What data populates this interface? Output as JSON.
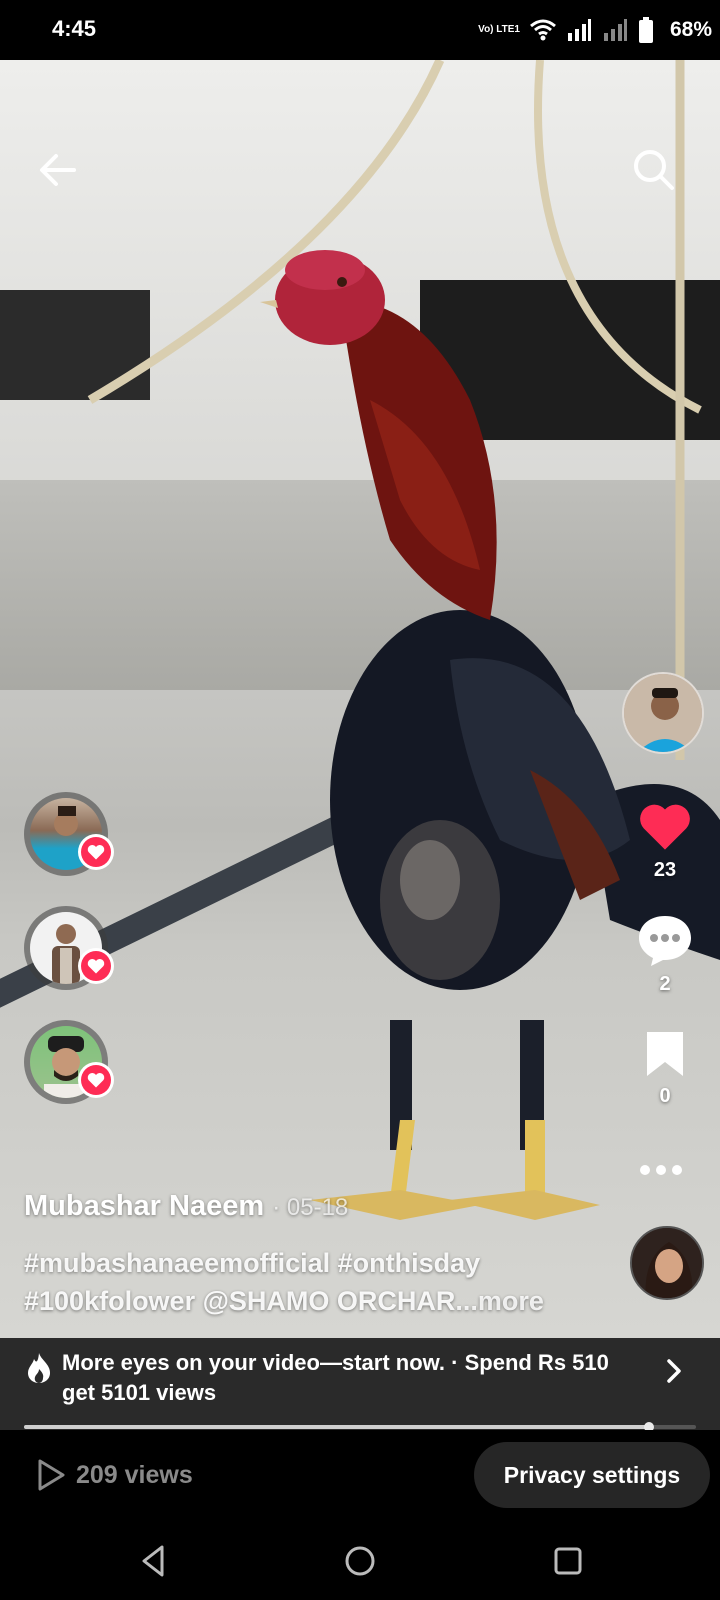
{
  "status": {
    "time": "4:45",
    "network_label": "Vo) LTE1",
    "battery_percent": "68%"
  },
  "video": {
    "author": "Mubashar Naeem",
    "date": "· 05-18",
    "caption_line1": "#mubashanaeemofficial #onthisday",
    "caption_line2": "#100kfolower @SHAMO ORCHAR",
    "more_label": "...more",
    "playback_progress": 0.93
  },
  "actions": {
    "likes": "23",
    "comments": "2",
    "saves": "0",
    "liked": true
  },
  "promo": {
    "text": "More eyes on your video—start now. · Spend Rs 510 get 5101 views"
  },
  "footer": {
    "views": "209 views",
    "privacy_label": "Privacy settings"
  },
  "colors": {
    "like_red": "#fe2c55",
    "banner_bg": "#2a2a2a"
  },
  "icons": {
    "back": "arrow-left-icon",
    "search": "search-icon",
    "like": "heart-icon",
    "comment": "comment-icon",
    "save": "bookmark-icon",
    "more": "more-dots-icon",
    "promo": "flame-icon",
    "views": "play-icon"
  }
}
